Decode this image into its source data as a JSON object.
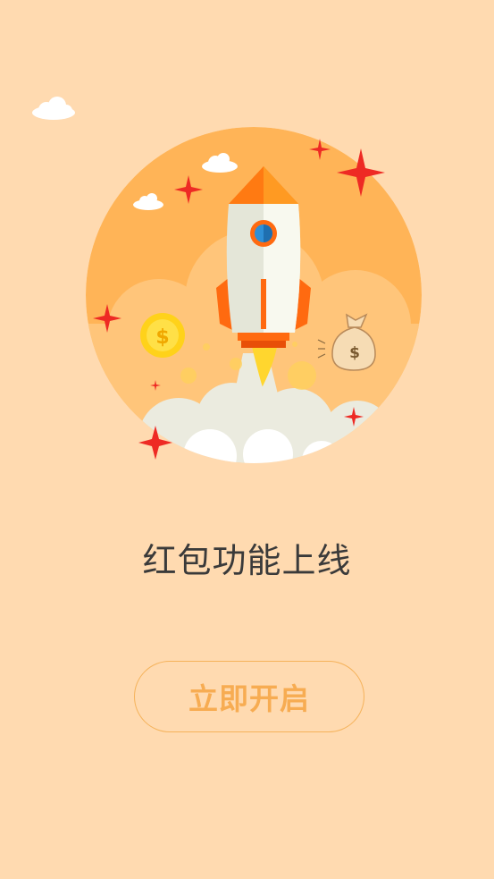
{
  "headline": "红包功能上线",
  "cta_label": "立即开启",
  "colors": {
    "background": "#ffdab0",
    "accent": "#f7ac52",
    "circle": "#ffb457",
    "rocket_body": "#eff1e6",
    "rocket_trim": "#ff6a10",
    "sparkle": "#ee2a24"
  },
  "icons": [
    "rocket-icon",
    "coin-icon",
    "money-bag-icon",
    "sparkle-icon",
    "cloud-icon"
  ],
  "money_bag_symbol": "$"
}
